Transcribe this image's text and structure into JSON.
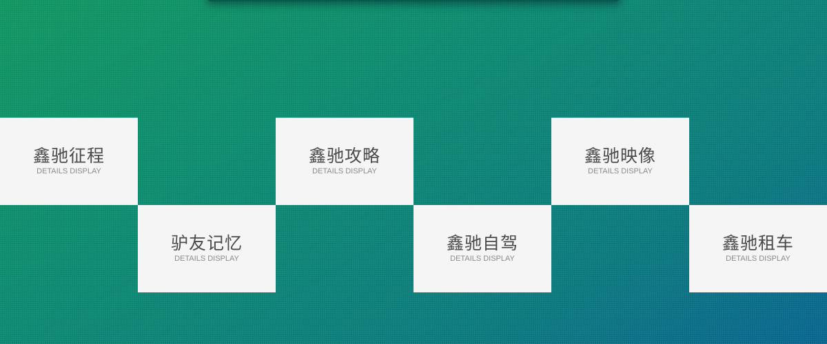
{
  "tiles": [
    {
      "title": "鑫驰征程",
      "subtitle": "DETAILS DISPLAY"
    },
    {
      "title": "鑫驰攻略",
      "subtitle": "DETAILS DISPLAY"
    },
    {
      "title": "鑫驰映像",
      "subtitle": "DETAILS DISPLAY"
    },
    {
      "title": "驴友记忆",
      "subtitle": "DETAILS DISPLAY"
    },
    {
      "title": "鑫驰自驾",
      "subtitle": "DETAILS DISPLAY"
    },
    {
      "title": "鑫驰租车",
      "subtitle": "DETAILS DISPLAY"
    }
  ],
  "colors": {
    "background_start": "#139662",
    "background_end": "#0b6690",
    "tile_background": "#f5f5f5",
    "tile_title": "#4a4a4a",
    "tile_subtitle": "#8b8b8b"
  }
}
